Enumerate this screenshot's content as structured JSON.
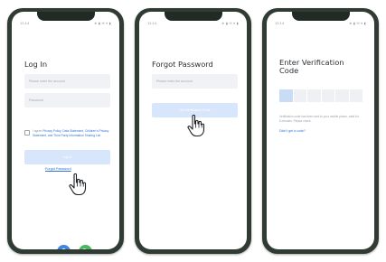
{
  "colors": {
    "phone_frame": "#2f3b33",
    "primary_button_disabled": "#d7e6fa",
    "link": "#2f73d4",
    "input_background": "#f1f2f5",
    "social_left": "#3f86e0",
    "social_right": "#46b95c"
  },
  "status_bar": {
    "time": "12:14",
    "icons": "⊕ ▮ ✉ ▾ ▮"
  },
  "login": {
    "title": "Log In",
    "account_placeholder": "Please enter the account",
    "password_placeholder": "Password",
    "agree_prefix": "I agree ",
    "agree_links": "Privacy Policy, Data Statement, Children's Privacy Statement, and Third Party Information Sharing List",
    "login_button": "Log In",
    "forgot_link": "Forgot Password",
    "social_icons": [
      "qq-icon",
      "wechat-icon"
    ]
  },
  "forgot_password": {
    "title": "Forgot Password",
    "account_placeholder": "Please enter the account",
    "confirm_button": "Get Verification Code"
  },
  "verification": {
    "title": "Enter Verification Code",
    "code_boxes": 6,
    "hint": "Verification code has been sent to your mobile phone, valid for 5 minutes. Please check.",
    "resend_link": "Didn't get a code?"
  },
  "cursor_icon": "hand-pointer-icon"
}
